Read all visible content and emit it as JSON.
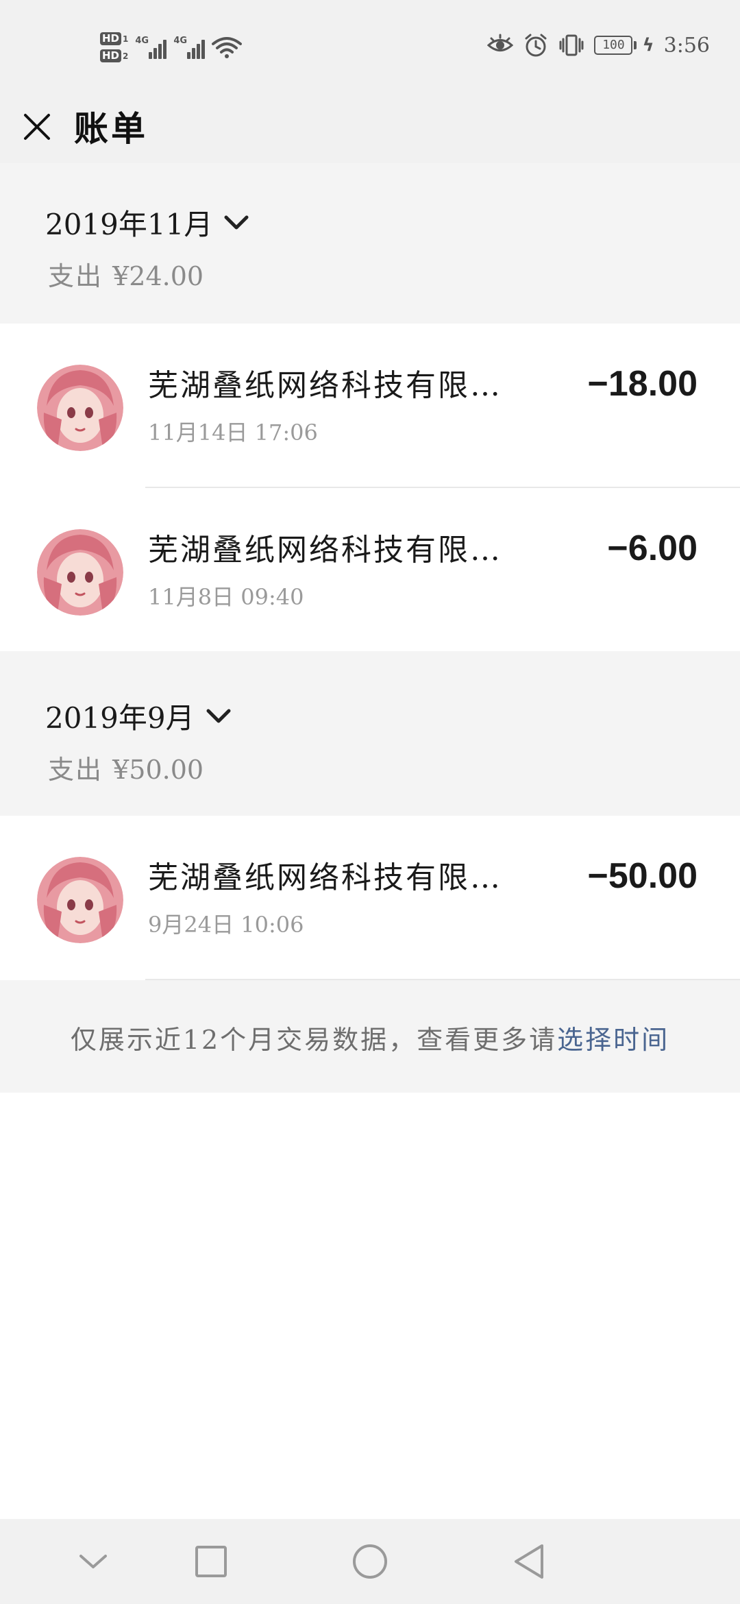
{
  "status_bar": {
    "sim1": "HD",
    "sim1_num": "1",
    "sim2": "HD",
    "sim2_num": "2",
    "net1": "4G",
    "net2": "4G",
    "battery": "100",
    "time": "3:56",
    "icons": [
      "eye-icon",
      "alarm-icon",
      "vibrate-icon",
      "battery-icon",
      "charging-icon",
      "wifi-icon",
      "signal-icon"
    ]
  },
  "header": {
    "title": "账单"
  },
  "months": [
    {
      "title": "2019年11月",
      "summary_label": "支出",
      "summary_amount": "¥24.00",
      "transactions": [
        {
          "name": "芜湖叠纸网络科技有限…",
          "time": "11月14日 17:06",
          "amount": "−18.00"
        },
        {
          "name": "芜湖叠纸网络科技有限…",
          "time": "11月8日 09:40",
          "amount": "−6.00"
        }
      ]
    },
    {
      "title": "2019年9月",
      "summary_label": "支出",
      "summary_amount": "¥50.00",
      "transactions": [
        {
          "name": "芜湖叠纸网络科技有限…",
          "time": "9月24日 10:06",
          "amount": "−50.00"
        }
      ]
    }
  ],
  "footer": {
    "note": "仅展示近12个月交易数据，查看更多请",
    "link": "选择时间"
  },
  "colors": {
    "link": "#4a6590",
    "header_bg": "#f1f1f1",
    "section_bg": "#f4f4f4"
  }
}
